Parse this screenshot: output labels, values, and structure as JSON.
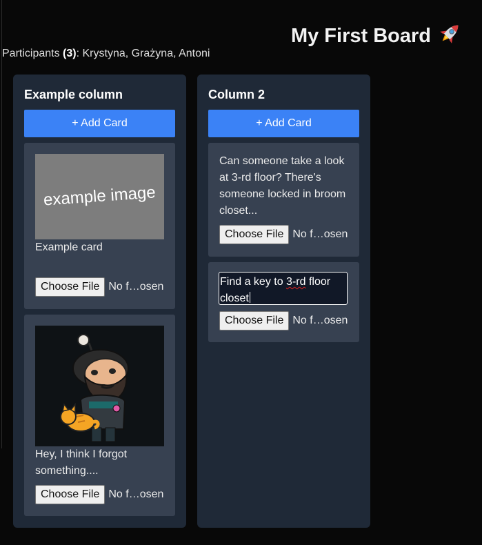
{
  "board": {
    "title": "My First Board",
    "title_icon": "rocket-icon",
    "participants_label": "Participants",
    "participants_count": "(3)",
    "participants_names": ": Krystyna, Grażyna, Antoni"
  },
  "columns": [
    {
      "title": "Example column",
      "add_label": "+ Add Card",
      "cards": [
        {
          "image_text": "example image",
          "text": "Example card",
          "file_button": "Choose File",
          "file_status": "No f…osen"
        },
        {
          "image_alt": "avatar-illustration",
          "text": "Hey, I think I forgot something....",
          "file_button": "Choose File",
          "file_status": "No f…osen"
        }
      ]
    },
    {
      "title": "Column 2",
      "add_label": "+ Add Card",
      "cards": [
        {
          "text": "Can someone take a look at 3-rd floor? There's someone locked in broom closet...",
          "file_button": "Choose File",
          "file_status": "No f…osen"
        },
        {
          "edit_prefix": "Find a key to ",
          "edit_flagged": "3-rd",
          "edit_suffix": " floor closet",
          "file_button": "Choose File",
          "file_status": "No f…osen"
        }
      ]
    }
  ],
  "colors": {
    "background": "#080808",
    "column_bg": "#1f2937",
    "card_bg": "#374151",
    "accent": "#3b82f6"
  }
}
